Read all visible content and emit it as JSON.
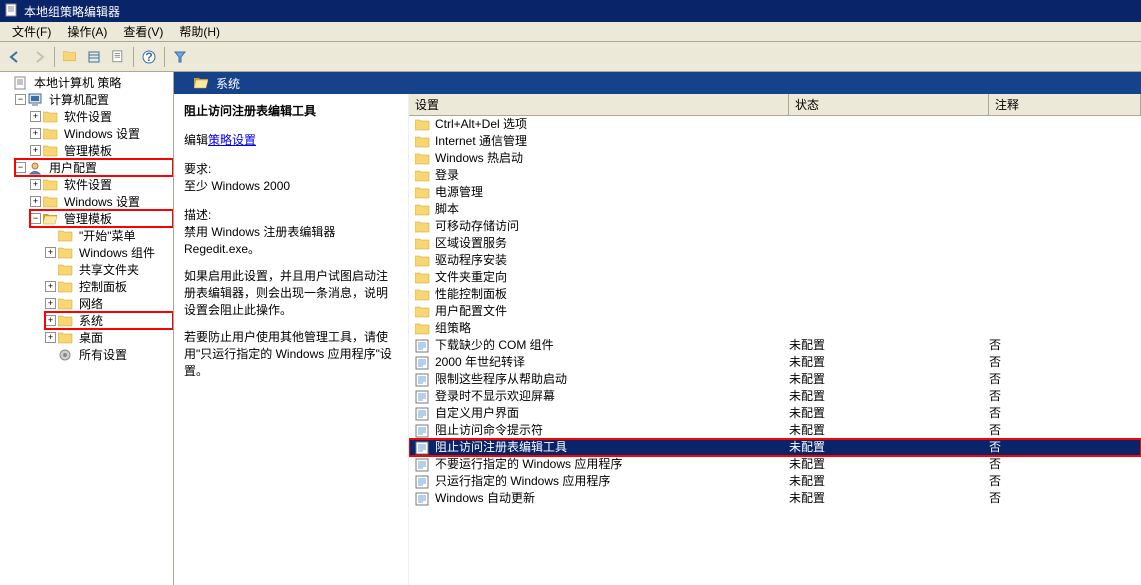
{
  "window": {
    "title": "本地组策略编辑器"
  },
  "menu": {
    "file": "文件(F)",
    "action": "操作(A)",
    "view": "查看(V)",
    "help": "帮助(H)"
  },
  "tree": {
    "root": "本地计算机 策略",
    "computer_cfg": "计算机配置",
    "cc_soft": "软件设置",
    "cc_win": "Windows 设置",
    "cc_admin": "管理模板",
    "user_cfg": "用户配置",
    "uc_soft": "软件设置",
    "uc_win": "Windows 设置",
    "uc_admin": "管理模板",
    "start_menu": "\"开始\"菜单",
    "win_comp": "Windows 组件",
    "shared": "共享文件夹",
    "ctrl_panel": "控制面板",
    "network": "网络",
    "system": "系统",
    "desktop": "桌面",
    "all": "所有设置"
  },
  "header": {
    "title": "系统"
  },
  "desc": {
    "title": "阻止访问注册表编辑工具",
    "edit_prefix": "编辑",
    "edit_link": "策略设置",
    "req_label": "要求:",
    "req_value": "至少 Windows 2000",
    "d_label": "描述:",
    "d1": "禁用 Windows 注册表编辑器 Regedit.exe。",
    "d2": "如果启用此设置，并且用户试图启动注册表编辑器，则会出现一条消息，说明设置会阻止此操作。",
    "d3": "若要防止用户使用其他管理工具，请使用\"只运行指定的 Windows 应用程序\"设置。"
  },
  "cols": {
    "setting": "设置",
    "state": "状态",
    "note": "注释"
  },
  "rows": [
    {
      "type": "folder",
      "name": "Ctrl+Alt+Del 选项"
    },
    {
      "type": "folder",
      "name": "Internet 通信管理"
    },
    {
      "type": "folder",
      "name": "Windows 热启动"
    },
    {
      "type": "folder",
      "name": "登录"
    },
    {
      "type": "folder",
      "name": "电源管理"
    },
    {
      "type": "folder",
      "name": "脚本"
    },
    {
      "type": "folder",
      "name": "可移动存储访问"
    },
    {
      "type": "folder",
      "name": "区域设置服务"
    },
    {
      "type": "folder",
      "name": "驱动程序安装"
    },
    {
      "type": "folder",
      "name": "文件夹重定向"
    },
    {
      "type": "folder",
      "name": "性能控制面板"
    },
    {
      "type": "folder",
      "name": "用户配置文件"
    },
    {
      "type": "folder",
      "name": "组策略"
    },
    {
      "type": "policy",
      "name": "下载缺少的 COM 组件",
      "state": "未配置",
      "note": "否"
    },
    {
      "type": "policy",
      "name": "2000 年世纪转译",
      "state": "未配置",
      "note": "否"
    },
    {
      "type": "policy",
      "name": "限制这些程序从帮助启动",
      "state": "未配置",
      "note": "否"
    },
    {
      "type": "policy",
      "name": "登录时不显示欢迎屏幕",
      "state": "未配置",
      "note": "否"
    },
    {
      "type": "policy",
      "name": "自定义用户界面",
      "state": "未配置",
      "note": "否"
    },
    {
      "type": "policy",
      "name": "阻止访问命令提示符",
      "state": "未配置",
      "note": "否"
    },
    {
      "type": "policy",
      "name": "阻止访问注册表编辑工具",
      "state": "未配置",
      "note": "否",
      "selected": true,
      "highlight": true
    },
    {
      "type": "policy",
      "name": "不要运行指定的 Windows 应用程序",
      "state": "未配置",
      "note": "否"
    },
    {
      "type": "policy",
      "name": "只运行指定的 Windows 应用程序",
      "state": "未配置",
      "note": "否"
    },
    {
      "type": "policy",
      "name": "Windows 自动更新",
      "state": "未配置",
      "note": "否"
    }
  ]
}
